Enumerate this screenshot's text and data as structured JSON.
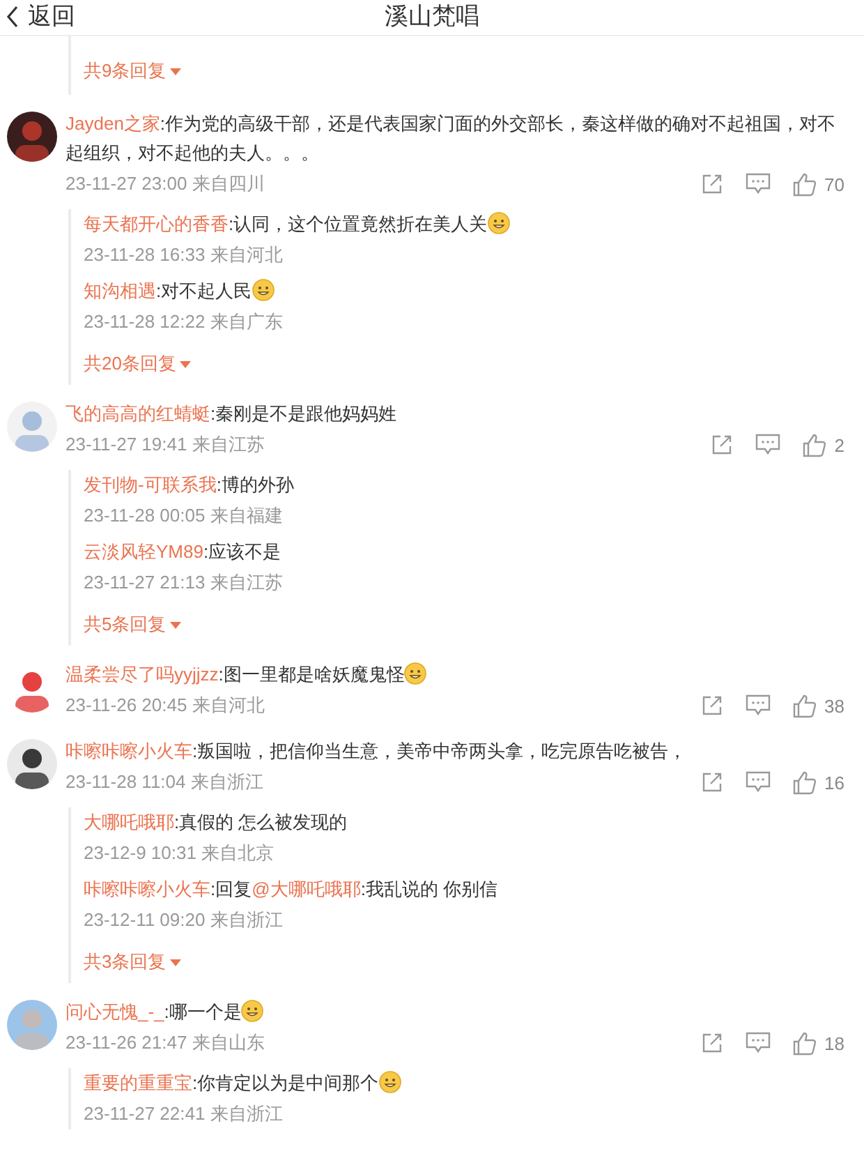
{
  "header": {
    "back": "返回",
    "title": "溪山梵唱"
  },
  "thread_tail": {
    "more": "共9条回复"
  },
  "comments": [
    {
      "user": "Jayden之家",
      "text": ":作为党的高级干部，还是代表国家门面的外交部长，秦这样做的确对不起祖国，对不起组织，对不起他的夫人。。。",
      "time": "23-11-27 23:00 来自四川",
      "likes": "70",
      "replies": [
        {
          "user": "每天都开心的香香",
          "text": ":认同，这个位置竟然折在美人关",
          "emoji": true,
          "time": "23-11-28 16:33 来自河北"
        },
        {
          "user": "知沟相遇",
          "text": ":对不起人民",
          "emoji": true,
          "time": "23-11-28 12:22 来自广东"
        }
      ],
      "more": "共20条回复"
    },
    {
      "user": "飞的高高的红蜻蜓",
      "text": ":秦刚是不是跟他妈妈姓",
      "time": "23-11-27 19:41 来自江苏",
      "likes": "2",
      "replies": [
        {
          "user": "发刊物-可联系我",
          "text": ":博的外孙",
          "time": "23-11-28 00:05 来自福建"
        },
        {
          "user": "云淡风轻YM89",
          "text": ":应该不是",
          "time": "23-11-27 21:13 来自江苏"
        }
      ],
      "more": "共5条回复"
    },
    {
      "user": "温柔尝尽了吗yyjjzz",
      "text": ":图一里都是啥妖魔鬼怪",
      "emoji": true,
      "time": "23-11-26 20:45 来自河北",
      "likes": "38"
    },
    {
      "user": "咔嚓咔嚓小火车",
      "text": ":叛国啦，把信仰当生意，美帝中帝两头拿，吃完原告吃被告，",
      "time": "23-11-28 11:04 来自浙江",
      "likes": "16",
      "replies": [
        {
          "user": "大哪吒哦耶",
          "text": ":真假的 怎么被发现的",
          "time": "23-12-9 10:31 来自北京"
        },
        {
          "user": "咔嚓咔嚓小火车",
          "prefix": ":回复",
          "mention": "@大哪吒哦耶",
          "text": ":我乱说的 你别信",
          "time": "23-12-11 09:20 来自浙江"
        }
      ],
      "more": "共3条回复"
    },
    {
      "user": "问心无愧_-_",
      "text": ":哪一个是",
      "emoji": true,
      "time": "23-11-26 21:47 来自山东",
      "likes": "18",
      "replies": [
        {
          "user": "重要的重重宝",
          "text": ":你肯定以为是中间那个",
          "emoji": true,
          "time": "23-11-27 22:41 来自浙江"
        }
      ]
    }
  ]
}
